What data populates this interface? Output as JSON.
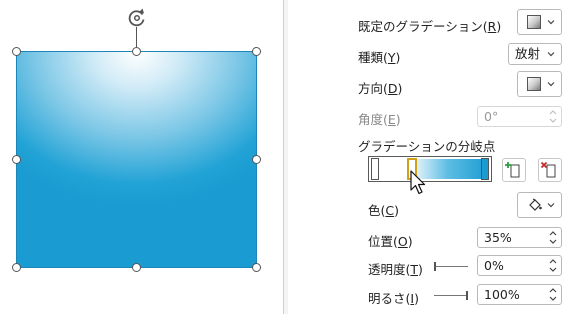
{
  "format_panel": {
    "preset_gradient": {
      "label": "既定のグラデーション(",
      "key": "R",
      "suffix": ")"
    },
    "type": {
      "label": "種類(",
      "key": "Y",
      "suffix": ")",
      "value": "放射"
    },
    "direction": {
      "label": "方向(",
      "key": "D",
      "suffix": ")"
    },
    "angle": {
      "label": "角度(",
      "key": "E",
      "suffix": ")",
      "value": "0°"
    },
    "gradient_stops": {
      "label": "グラデーションの分岐点",
      "stops": [
        {
          "position": 0.0,
          "color": "#ffffff"
        },
        {
          "position": 0.35,
          "color": "#ffffff"
        },
        {
          "position": 1.0,
          "color": "#1a9bd1"
        }
      ]
    },
    "color": {
      "label": "色(",
      "key": "C",
      "suffix": ")"
    },
    "position": {
      "label": "位置(",
      "key": "O",
      "suffix": ")",
      "value": "35%"
    },
    "transparency": {
      "label": "透明度(",
      "key": "T",
      "suffix": ")",
      "value": "0%"
    },
    "brightness": {
      "label": "明るさ(",
      "key": "I",
      "suffix": ")",
      "value": "100%"
    }
  },
  "colors": {
    "gradient_light": "#ffffff",
    "gradient_dark": "#1a9bd1",
    "selected_stop_border": "#d4a017",
    "add_stop_green": "#2e9e3f",
    "remove_stop_red": "#c62828"
  },
  "icons": {
    "rotate_handle": "rotate-icon",
    "add_stop": "add-gradient-stop-icon",
    "remove_stop": "remove-gradient-stop-icon",
    "color_picker": "paint-bucket-icon",
    "cursor": "mouse-pointer-icon"
  }
}
